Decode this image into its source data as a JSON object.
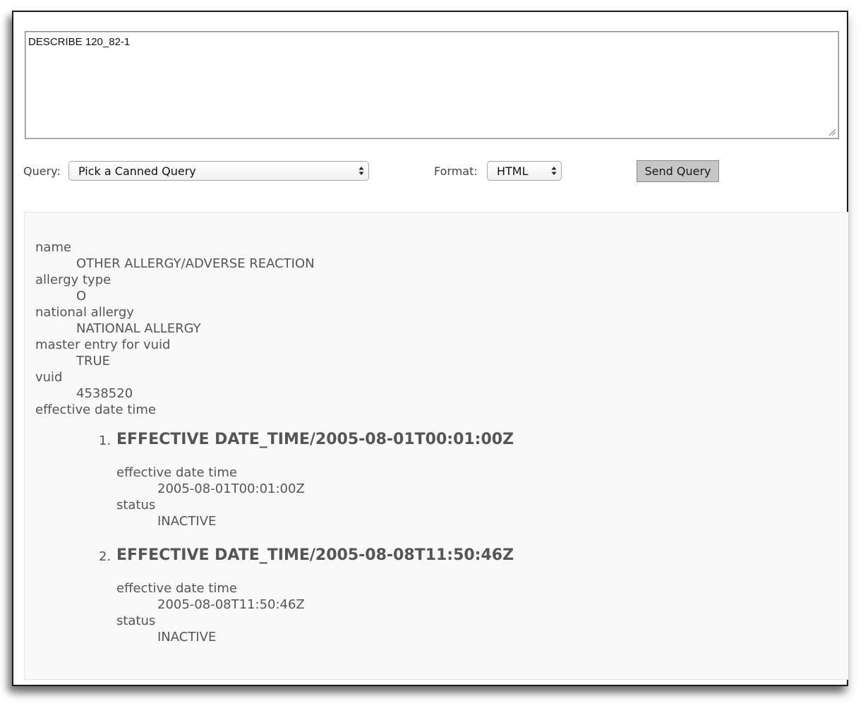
{
  "query": {
    "text": "DESCRIBE 120_82-1"
  },
  "controls": {
    "query_label": "Query:",
    "query_select_value": "Pick a Canned Query",
    "format_label": "Format:",
    "format_select_value": "HTML",
    "send_label": "Send Query"
  },
  "result": {
    "properties": [
      {
        "label": "name",
        "value": "OTHER ALLERGY/ADVERSE REACTION"
      },
      {
        "label": "allergy type",
        "value": "O"
      },
      {
        "label": "national allergy",
        "value": "NATIONAL ALLERGY"
      },
      {
        "label": "master entry for vuid",
        "value": "TRUE"
      },
      {
        "label": "vuid",
        "value": "4538520"
      }
    ],
    "effective_label": "effective date time",
    "entries": [
      {
        "number": "1.",
        "title": "EFFECTIVE DATE_TIME/2005-08-01T00:01:00Z",
        "date_label": "effective date time",
        "date_value": "2005-08-01T00:01:00Z",
        "status_label": "status",
        "status_value": "INACTIVE"
      },
      {
        "number": "2.",
        "title": "EFFECTIVE DATE_TIME/2005-08-08T11:50:46Z",
        "date_label": "effective date time",
        "date_value": "2005-08-08T11:50:46Z",
        "status_label": "status",
        "status_value": "INACTIVE"
      }
    ]
  }
}
